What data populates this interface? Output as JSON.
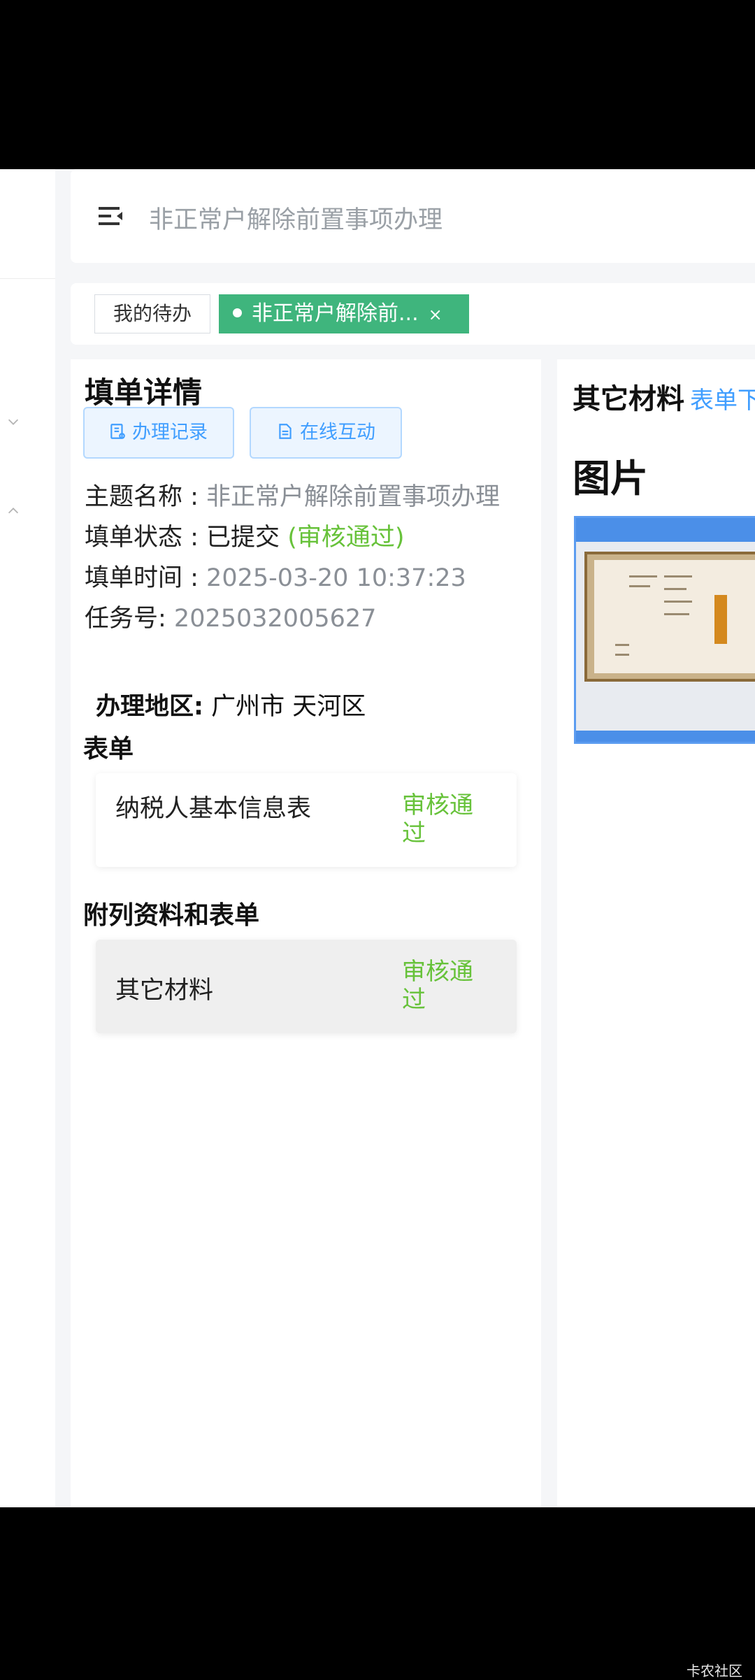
{
  "header": {
    "title": "非正常户解除前置事项办理"
  },
  "tabs": {
    "items": [
      {
        "label": "我的待办"
      },
      {
        "label": "非正常户解除前...",
        "close": "×",
        "active": true
      }
    ]
  },
  "detail": {
    "title": "填单详情",
    "buttons": {
      "records": "办理记录",
      "interact": "在线互动"
    },
    "subject_label": "主题名称 : ",
    "subject_value": "非正常户解除前置事项办理",
    "status_label": "填单状态 : ",
    "status_value": "已提交",
    "status_review": "(审核通过)",
    "time_label": "填单时间 : ",
    "time_value": "2025-03-20 10:37:23",
    "task_label": "任务号: ",
    "task_value": "2025032005627"
  },
  "forms": {
    "region_label": "办理地区:",
    "region_value": "广州市 天河区",
    "forms_title": "表单",
    "form_items": [
      {
        "name": "纳税人基本信息表",
        "status": "审核通过"
      }
    ],
    "attachments_title": "附列资料和表单",
    "attachment_items": [
      {
        "name": "其它材料",
        "status": "审核通过"
      }
    ]
  },
  "right_panel": {
    "title": "其它材料",
    "link": "表单下",
    "pictures_title": "图片"
  },
  "watermark": "卡农社区",
  "colors": {
    "accent_green": "#3fb57d",
    "status_green": "#67c23a",
    "link_blue": "#409eff"
  }
}
